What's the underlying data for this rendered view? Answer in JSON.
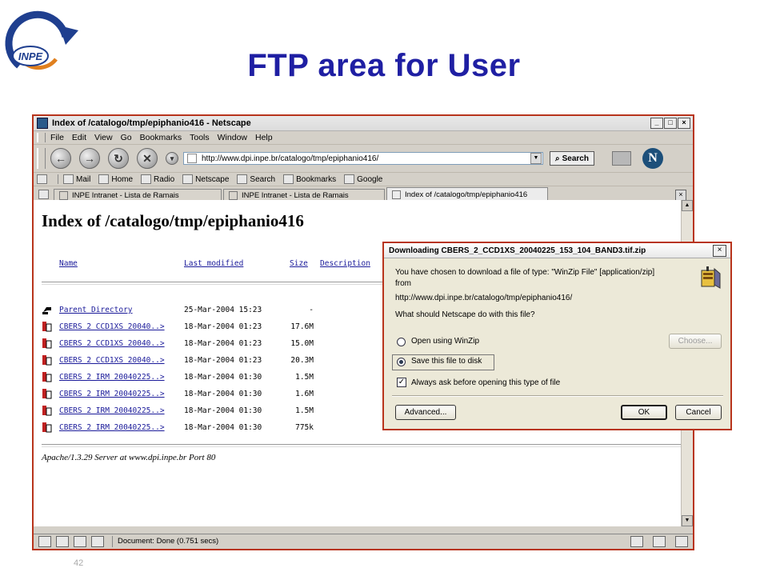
{
  "slide": {
    "title": "FTP area for User",
    "logo_text": "INPE",
    "page_number": "42"
  },
  "browser": {
    "window_title": "Index of /catalogo/tmp/epiphanio416 - Netscape",
    "menu": [
      "File",
      "Edit",
      "View",
      "Go",
      "Bookmarks",
      "Tools",
      "Window",
      "Help"
    ],
    "url": "http://www.dpi.inpe.br/catalogo/tmp/epiphanio416/",
    "search_label": "Search",
    "personal_toolbar": [
      "Mail",
      "Home",
      "Radio",
      "Netscape",
      "Search",
      "Bookmarks",
      "Google"
    ],
    "tabs": [
      {
        "label": "INPE Intranet - Lista de Ramais",
        "active": false
      },
      {
        "label": "INPE Intranet - Lista de Ramais",
        "active": false
      },
      {
        "label": "Index of /catalogo/tmp/epiphanio416",
        "active": true
      }
    ],
    "status_text": "Document: Done (0.751 secs)"
  },
  "page": {
    "heading": "Index of /catalogo/tmp/epiphanio416",
    "columns": {
      "name": "Name",
      "last_modified": "Last modified",
      "size": "Size",
      "description": "Description"
    },
    "files": [
      {
        "icon": "parent-directory-icon",
        "name": "Parent Directory",
        "date": "25-Mar-2004 15:23",
        "size": "-"
      },
      {
        "icon": "file-icon",
        "name": "CBERS 2 CCD1XS 20040..>",
        "date": "18-Mar-2004 01:23",
        "size": "17.6M"
      },
      {
        "icon": "file-icon",
        "name": "CBERS 2 CCD1XS 20040..>",
        "date": "18-Mar-2004 01:23",
        "size": "15.0M"
      },
      {
        "icon": "file-icon",
        "name": "CBERS 2 CCD1XS 20040..>",
        "date": "18-Mar-2004 01:23",
        "size": "20.3M"
      },
      {
        "icon": "file-icon",
        "name": "CBERS 2 IRM 20040225..>",
        "date": "18-Mar-2004 01:30",
        "size": "1.5M"
      },
      {
        "icon": "file-icon",
        "name": "CBERS 2 IRM 20040225..>",
        "date": "18-Mar-2004 01:30",
        "size": "1.6M"
      },
      {
        "icon": "file-icon",
        "name": "CBERS 2 IRM 20040225..>",
        "date": "18-Mar-2004 01:30",
        "size": "1.5M"
      },
      {
        "icon": "file-icon",
        "name": "CBERS 2 IRM 20040225..>",
        "date": "18-Mar-2004 01:30",
        "size": "775k"
      }
    ],
    "server_signature": "Apache/1.3.29 Server at www.dpi.inpe.br Port 80"
  },
  "dialog": {
    "title": "Downloading CBERS_2_CCD1XS_20040225_153_104_BAND3.tif.zip",
    "line1": "You have chosen to download a file of type: \"WinZip File\" [application/zip]",
    "line2": "from",
    "source_url": "http://www.dpi.inpe.br/catalogo/tmp/epiphanio416/",
    "question": "What should Netscape do with this file?",
    "option_open": "Open using WinZip",
    "option_save": "Save this file to disk",
    "selected_option": "save",
    "choose_button": "Choose...",
    "always_ask_label": "Always ask before opening this type of file",
    "always_ask_checked": true,
    "advanced_button": "Advanced...",
    "ok_button": "OK",
    "cancel_button": "Cancel"
  }
}
